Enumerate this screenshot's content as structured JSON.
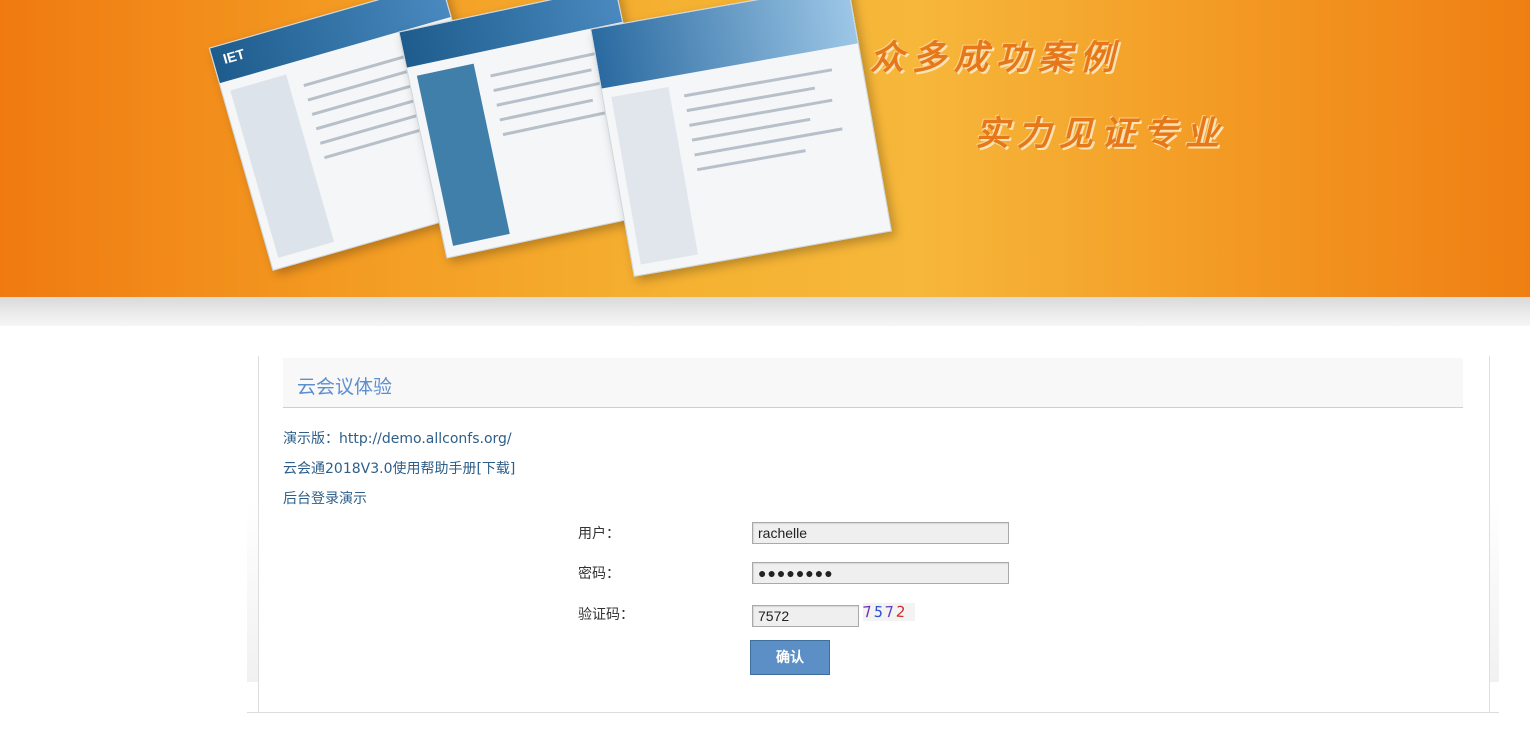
{
  "banner": {
    "slogan_line1": "众多成功案例",
    "slogan_line2": "实力见证专业",
    "logo_text": "IET"
  },
  "section": {
    "title": "云会议体验"
  },
  "links": {
    "demo": "演示版：http://demo.allconfs.org/",
    "manual": "云会通2018V3.0使用帮助手册[下载]",
    "backend": "后台登录演示"
  },
  "form": {
    "user_label": "用户：",
    "user_value": "rachelle",
    "password_label": "密码：",
    "password_value": "●●●●●●●●",
    "captcha_label": "验证码：",
    "captcha_value": "7572",
    "captcha_image_digits": [
      "7",
      "5",
      "7",
      "2"
    ],
    "submit_label": "确认"
  },
  "colors": {
    "banner_orange": "#f39a22",
    "title_blue": "#5d8fcf",
    "link_blue": "#2d5f8a",
    "button_blue": "#5b8fc5"
  }
}
